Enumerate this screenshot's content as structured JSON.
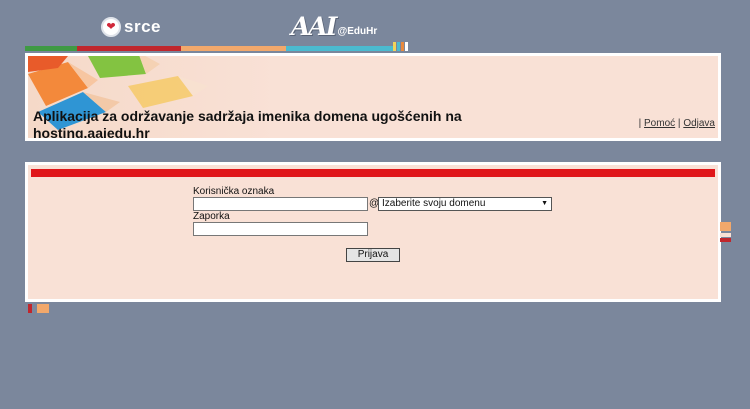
{
  "header": {
    "srce_logo_text": "srce",
    "aai_logo_mark": "AAI",
    "aai_logo_suffix": "@EduHr"
  },
  "banner": {
    "title": "Aplikacija za održavanje sadržaja imenika domena ugošćenih na hosting.aaiedu.hr",
    "sep1": "|",
    "help_link": "Pomoć",
    "sep2": "|",
    "logout_link": "Odjava"
  },
  "login": {
    "username_label": "Korisnička oznaka",
    "username_value": "",
    "at_sign": "@",
    "domain_select_value": "Izaberite svoju domenu",
    "password_label": "Zaporka",
    "password_value": "",
    "submit_label": "Prijava"
  },
  "colors": {
    "background": "#7b879c",
    "panel": "#f9e1d6",
    "accent_red": "#e0161a",
    "stripe_green": "#3f9a43",
    "stripe_red": "#c0262c",
    "stripe_orange": "#f2a86b",
    "stripe_cyan": "#4bbbd0"
  }
}
